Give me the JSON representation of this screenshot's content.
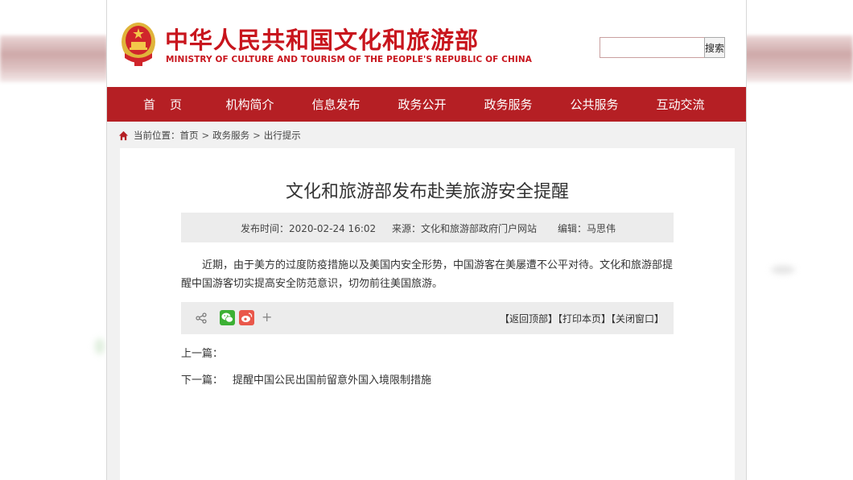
{
  "header": {
    "title_cn": "中华人民共和国文化和旅游部",
    "title_en": "MINISTRY OF CULTURE AND TOURISM OF THE PEOPLE'S REPUBLIC OF CHINA"
  },
  "search": {
    "placeholder": "",
    "value": "",
    "button_label": "搜索"
  },
  "nav": {
    "items": [
      {
        "label": "首页"
      },
      {
        "label": "机构简介"
      },
      {
        "label": "信息发布"
      },
      {
        "label": "政务公开"
      },
      {
        "label": "政务服务"
      },
      {
        "label": "公共服务"
      },
      {
        "label": "互动交流"
      }
    ]
  },
  "breadcrumb": {
    "prefix": "当前位置：",
    "items": [
      "首页",
      "政务服务",
      "出行提示"
    ],
    "separator": ">"
  },
  "article": {
    "title": "文化和旅游部发布赴美旅游安全提醒",
    "date": "发布时间：2020-02-24 16:02",
    "source": "来源：文化和旅游部政府门户网站",
    "editor": "编辑：马思伟",
    "body": "近期，由于美方的过度防疫措施以及美国内安全形势，中国游客在美屡遭不公平对待。文化和旅游部提醒中国游客切实提高安全防范意识，切勿前往美国旅游。"
  },
  "share": {
    "icons": [
      "share-icon",
      "wechat-icon",
      "weibo-icon",
      "plus-icon"
    ],
    "plus_label": "+",
    "back_top": "【返回顶部】",
    "print": "【打印本页】",
    "close": "【关闭窗口】"
  },
  "pagination": {
    "prev_label": "上一篇：",
    "next_label": "下一篇：",
    "next_title": "提醒中国公民出国前留意外国入境限制措施"
  },
  "colors": {
    "brand_red": "#b51f24",
    "title_red": "#c8151d",
    "page_bg": "#f1f1f1",
    "meta_bg": "#ececec"
  }
}
